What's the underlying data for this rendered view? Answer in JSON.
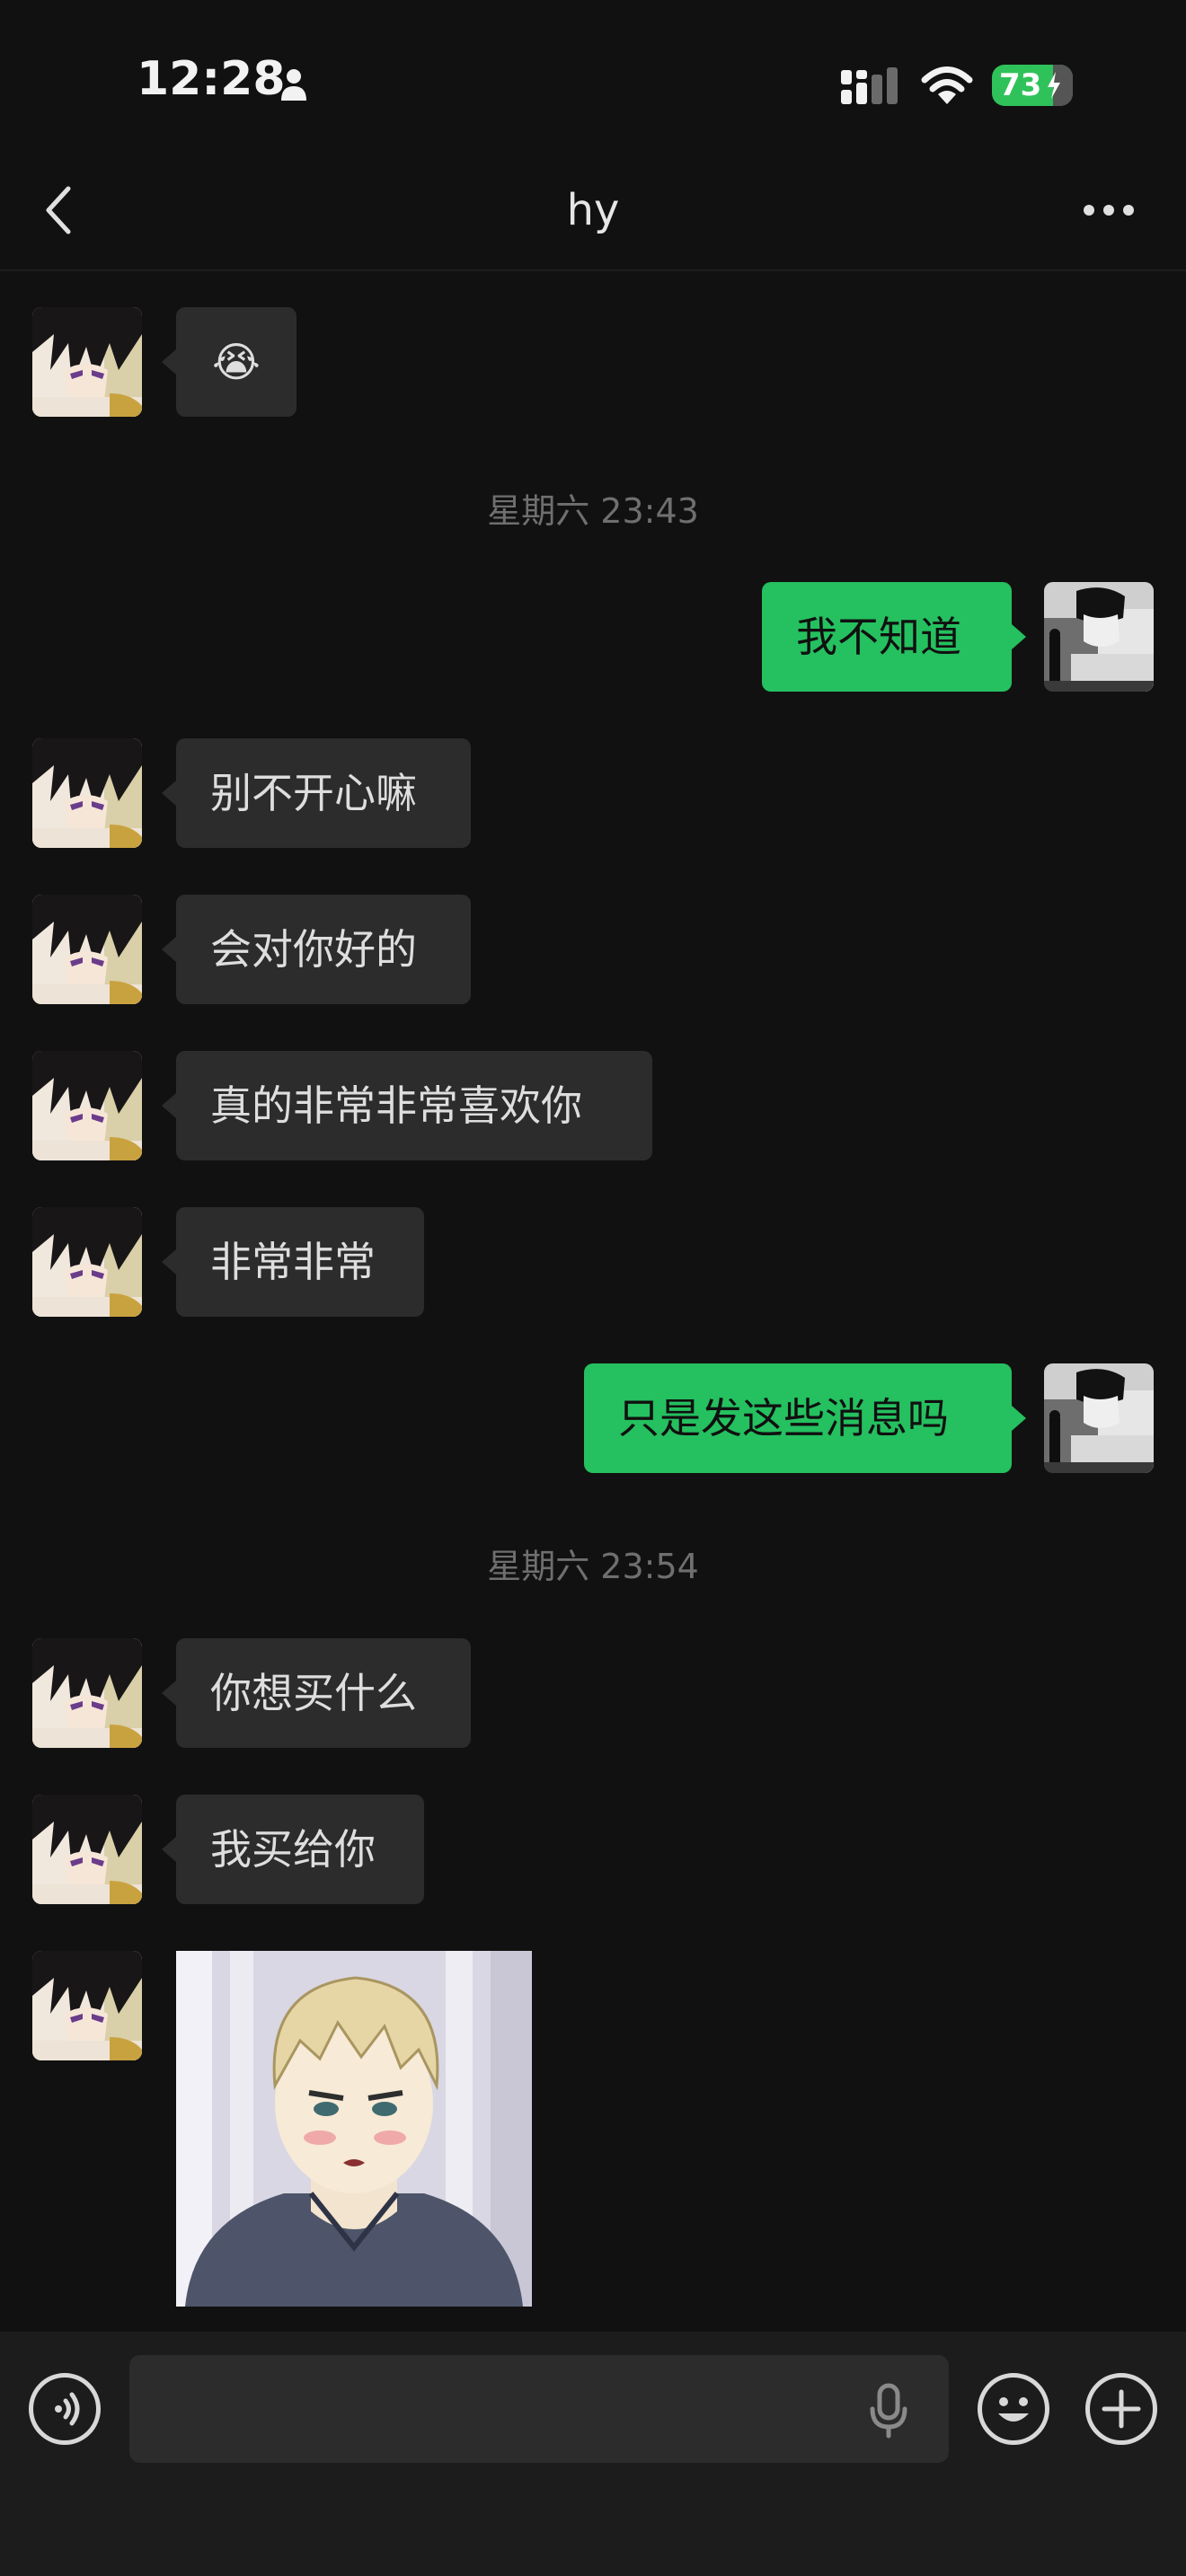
{
  "status_bar": {
    "time": "12:28",
    "battery": "73"
  },
  "header": {
    "title": "hy"
  },
  "messages": [
    {
      "side": "in",
      "type": "emoji",
      "text": "😭"
    },
    {
      "type": "timestamp",
      "text": "星期六 23:43"
    },
    {
      "side": "out",
      "type": "text",
      "text": "我不知道"
    },
    {
      "side": "in",
      "type": "text",
      "text": "别不开心嘛"
    },
    {
      "side": "in",
      "type": "text",
      "text": "会对你好的"
    },
    {
      "side": "in",
      "type": "text",
      "text": "真的非常非常喜欢你"
    },
    {
      "side": "in",
      "type": "text",
      "text": "非常非常"
    },
    {
      "side": "out",
      "type": "text",
      "text": "只是发这些消息吗"
    },
    {
      "type": "timestamp",
      "text": "星期六 23:54"
    },
    {
      "side": "in",
      "type": "text",
      "text": "你想买什么"
    },
    {
      "side": "in",
      "type": "text",
      "text": "我买给你"
    },
    {
      "side": "in",
      "type": "image",
      "image": "anime-character-sticker"
    }
  ],
  "input": {
    "value": ""
  },
  "icons": {
    "back": "chevron-left-icon",
    "more": "more-dots-icon",
    "voice": "voice-mode-icon",
    "mic": "microphone-icon",
    "emoji": "emoji-icon",
    "add": "plus-icon"
  },
  "colors": {
    "outgoing_bubble": "#25c05f",
    "incoming_bubble": "#2c2c2c",
    "background": "#111111",
    "battery": "#2fc25a"
  }
}
